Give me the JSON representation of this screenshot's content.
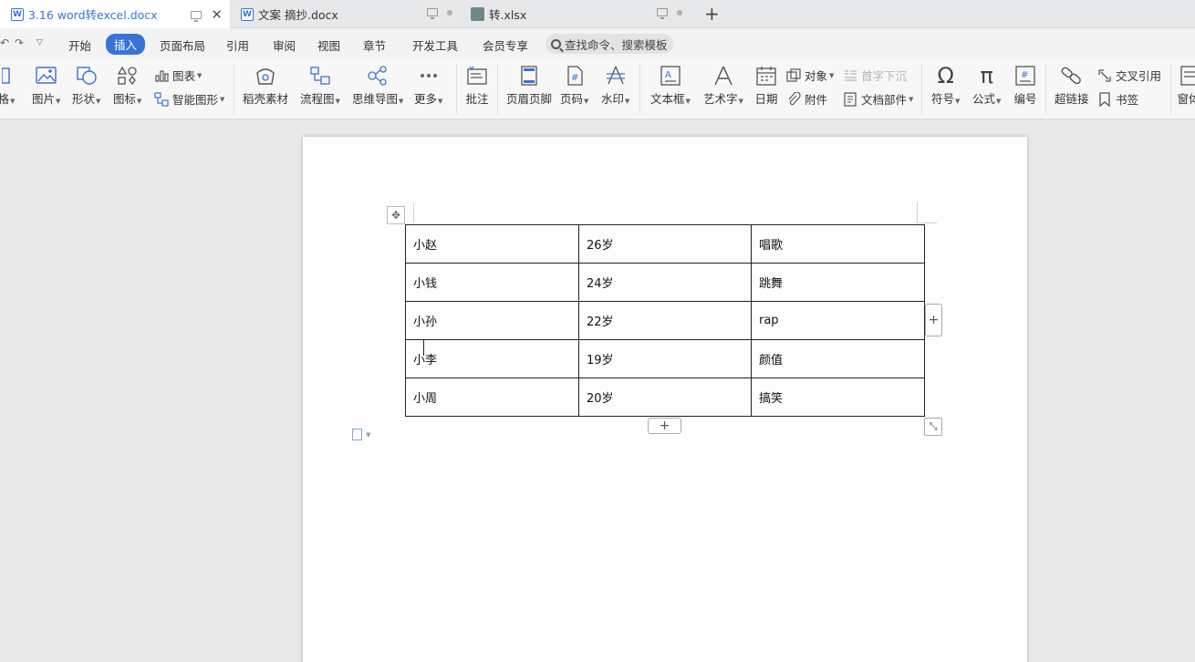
{
  "tabs": [
    {
      "title": "3.16 word转excel.docx",
      "type": "docx",
      "active": true
    },
    {
      "title": "文案 摘抄.docx",
      "type": "docx",
      "active": false
    },
    {
      "title": "转.xlsx",
      "type": "xlsx",
      "active": false
    }
  ],
  "tab_icons": {
    "docx": "W"
  },
  "menu": [
    "开始",
    "插入",
    "页面布局",
    "引用",
    "审阅",
    "视图",
    "章节",
    "开发工具",
    "会员专享"
  ],
  "active_menu": "插入",
  "search": {
    "placeholder": "查找命令、搜索模板"
  },
  "ribbon": {
    "partial_left": "格",
    "picture": "图片",
    "shape": "形状",
    "icons": "图标",
    "chart": "图表",
    "smartart": "智能图形",
    "material": "稻壳素材",
    "flowchart": "流程图",
    "mindmap": "思维导图",
    "more": "更多",
    "comment": "批注",
    "header_footer": "页眉页脚",
    "page_number": "页码",
    "watermark": "水印",
    "textbox": "文本框",
    "wordart": "艺术字",
    "date": "日期",
    "object": "对象",
    "attachment": "附件",
    "dropcap": "首字下沉",
    "doc_parts": "文档部件",
    "symbol": "符号",
    "formula": "公式",
    "numbering": "编号",
    "hyperlink": "超链接",
    "cross_ref": "交叉引用",
    "bookmark": "书签",
    "partial_right": "窗体"
  },
  "table": [
    [
      "小赵",
      "26岁",
      "唱歌"
    ],
    [
      "小钱",
      "24岁",
      "跳舞"
    ],
    [
      "小孙",
      "22岁",
      "rap"
    ],
    [
      "小李",
      "19岁",
      "颜值"
    ],
    [
      "小周",
      "20岁",
      "搞笑"
    ]
  ],
  "controls": {
    "add": "+"
  },
  "colors": {
    "accent": "#3a73d6",
    "workspace": "#e9e9e9",
    "page": "#fdfdfd"
  }
}
